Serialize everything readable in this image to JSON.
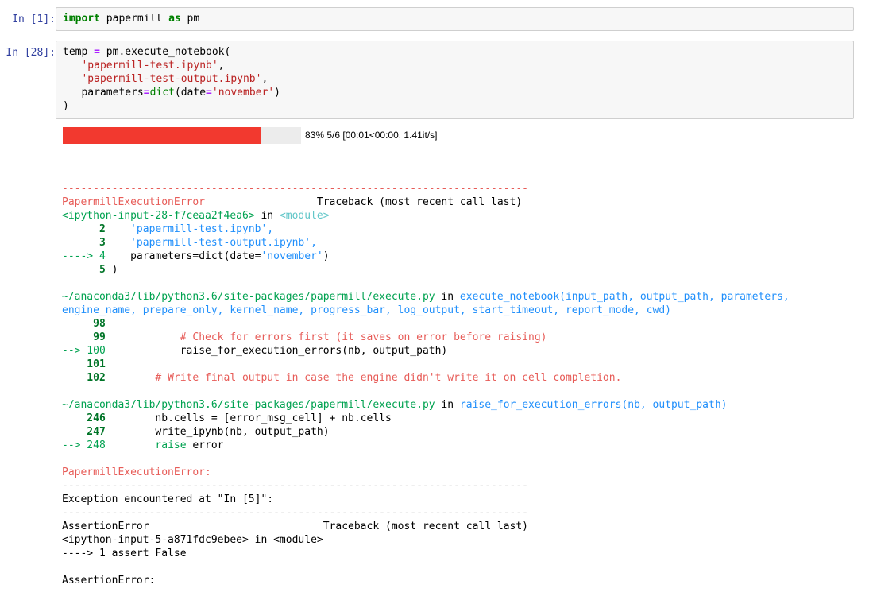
{
  "cell1": {
    "prompt": "In [1]:",
    "code": {
      "kw1": "import",
      "mod": " papermill ",
      "kw2": "as",
      "alias": " pm"
    }
  },
  "cell2": {
    "prompt": "In [28]:",
    "lines": {
      "l1_a": "temp ",
      "l1_op": "=",
      "l1_b": " pm.execute_notebook(",
      "l2_s": "'papermill-test.ipynb'",
      "l2_c": ",",
      "l3_s": "'papermill-test-output.ipynb'",
      "l3_c": ",",
      "l4_a": "parameters",
      "l4_op": "=",
      "l4_bi": "dict",
      "l4_b": "(date",
      "l4_op2": "=",
      "l4_s": "'november'",
      "l4_c": ")",
      "l5": ")"
    }
  },
  "progress": {
    "percent": 83,
    "text": "83% 5/6 [00:01<00:00, 1.41it/s]"
  },
  "traceback": {
    "sep": "---------------------------------------------------------------------------",
    "err_name": "PapermillExecutionError",
    "tb_header": "                  Traceback (most recent call last)",
    "f1_input": "<ipython-input-28-f7ceaa2f4ea6>",
    "f1_in": " in ",
    "f1_mod": "<module>",
    "f1_l2_num": "      2",
    "f1_l2_code": "'papermill-test.ipynb',",
    "f1_l3_num": "      3",
    "f1_l3_code": "'papermill-test-output.ipynb',",
    "f1_l4_arrow": "----> 4",
    "f1_l4_a": "parameters=dict(date=",
    "f1_l4_s": "'november'",
    "f1_l4_c": ")",
    "f1_l5_num": "      5",
    "f1_l5_code": " )",
    "f2_path": "~/anaconda3/lib/python3.6/site-packages/papermill/execute.py",
    "f2_in": " in ",
    "f2_func1": "execute_notebook(input_path, output_path, parameters,",
    "f2_func2": "engine_name, prepare_only, kernel_name, progress_bar, log_output, start_timeout, report_mode, cwd)",
    "f2_98": "     98",
    "f2_99": "     99",
    "f2_99_code": "            # Check for errors first (it saves on error before raising)",
    "f2_100_arrow": "--> 100",
    "f2_100_code": "            raise_for_execution_errors(nb, output_path)",
    "f2_101": "    101",
    "f2_102": "    102",
    "f2_102_code": "        # Write final output in case the engine didn't write it on cell completion.",
    "f3_path": "~/anaconda3/lib/python3.6/site-packages/papermill/execute.py",
    "f3_in": " in ",
    "f3_func": "raise_for_execution_errors(nb, output_path)",
    "f3_246": "    246",
    "f3_246_code": "        nb.cells = [error_msg_cell] + nb.cells",
    "f3_247": "    247",
    "f3_247_code": "        write_ipynb(nb, output_path)",
    "f3_248_arrow": "--> 248",
    "f3_248_kw": "        raise",
    "f3_248_code": " error",
    "err_label": "PapermillExecutionError:",
    "exc_line": "Exception encountered at \"In [5]\":",
    "assert_name": "AssertionError",
    "assert_header": "                            Traceback (most recent call last)",
    "assert_input": "<ipython-input-5-a871fdc9ebee> in <module>",
    "assert_line": "----> 1 assert False",
    "assert_final": "AssertionError:"
  },
  "colors": {
    "prompt": "#303f9f",
    "progress_fill": "#f2392f",
    "progress_track": "#ececec"
  }
}
